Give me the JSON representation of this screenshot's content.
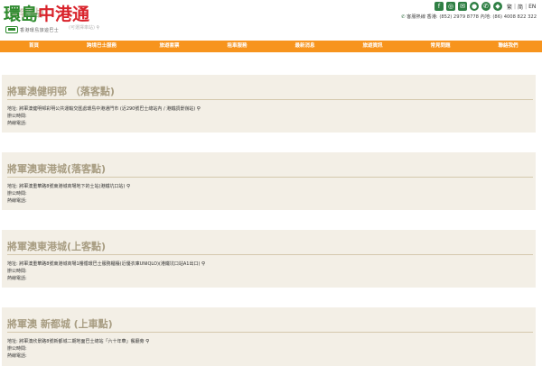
{
  "ghost_title": "(落客點)",
  "header": {
    "logo_part1": "環島",
    "logo_part2": "中港通",
    "logo_tagline": "香港環島旅遊巴士",
    "search_hint": "(可選擇車站)",
    "social_icons": [
      "facebook-icon",
      "instagram-icon",
      "wechat-icon",
      "weibo-icon",
      "whatsapp-icon",
      "line-icon"
    ],
    "lang": [
      "繁",
      "简",
      "EN"
    ],
    "hotline": "客服熱線 香港: (852) 2979 8778 內地: (86) 4008 822 322"
  },
  "nav": [
    "首頁",
    "跨境巴士服務",
    "旅遊套票",
    "租車服務",
    "最新消息",
    "旅遊資訊",
    "常見問題",
    "聯絡我們"
  ],
  "stations": [
    {
      "title": "將軍澳健明邨 （落客點)",
      "address": "地址: 將軍澳健明邨彩明公共運輸交匯處環島中港通門市 (近290號巴士總站內 / 港鐵調景嶺站)",
      "hours": "辦公時間:",
      "phone": "熱線電話:"
    },
    {
      "title": "將軍澳東港城(落客點)",
      "address": "地址: 將軍澳重華路8號東港城商場地下的士站(港鐵坑口站)",
      "hours": "辦公時間:",
      "phone": "熱線電話:"
    },
    {
      "title": "將軍澳東港城(上客點)",
      "address": "地址: 將軍澳重華路8號東港城商場1樓循環巴士服務櫃檯(近優衣庫UNIQLO)(港鐵坑口站A1出口)",
      "hours": "辦公時間:",
      "phone": "熱線電話:"
    },
    {
      "title": "將軍澳 新都城 (上車點)",
      "address": "地址: 將軍澳欣景路8號新都城二期地面巴士總站「六十年華」餐廳旁",
      "hours": "辦公時間:",
      "phone": "熱線電話:"
    }
  ]
}
